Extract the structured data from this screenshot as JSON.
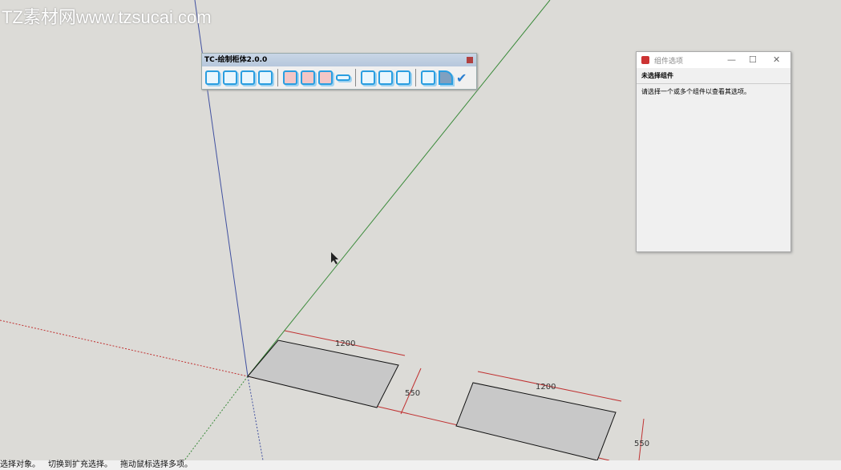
{
  "watermark": "TZ素材网www.tzsucai.com",
  "toolbar": {
    "title": "TC-绘制柜体2.0.0",
    "groups": [
      [
        "box",
        "box",
        "drawer",
        "drawer"
      ],
      [
        "door",
        "door",
        "door",
        "shelf"
      ],
      [
        "drawer",
        "panel",
        "panel"
      ],
      [
        "grid",
        "prism",
        "check"
      ]
    ]
  },
  "dialog": {
    "title": "组件选项",
    "minimize": "—",
    "maximize": "☐",
    "close": "✕",
    "heading": "未选择组件",
    "message": "请选择一个或多个组件以查看其选项。"
  },
  "dimensions": {
    "width1": "1200",
    "depth1": "550",
    "width2": "1200",
    "depth2": "550"
  },
  "status": {
    "items": [
      "选择对象。",
      "切换到扩充选择。",
      "拖动鼠标选择多项。"
    ]
  },
  "colors": {
    "blue_axis": "#4050a0",
    "green_axis": "#3a8a3a",
    "red": "#c03030"
  }
}
